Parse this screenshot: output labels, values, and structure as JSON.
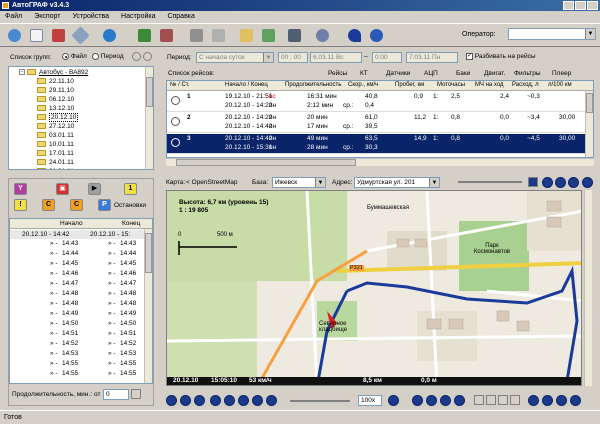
{
  "window": {
    "title": "АвтоГРАФ v3.4.3"
  },
  "menu": [
    "Файл",
    "Экспорт",
    "Устройства",
    "Настройка",
    "Справка"
  ],
  "toolbar": {
    "operator_label": "Оператор:",
    "operator_value": ""
  },
  "groups": {
    "label": "Список групп:",
    "mode_file": "Файл",
    "mode_period": "Период",
    "root": "Автобус - ВА892",
    "dates": [
      "22.11.10",
      "29.11.10",
      "06.12.10",
      "13.12.10",
      "20.12.10",
      "27.12.10",
      "03.01.11",
      "10.01.11",
      "17.01.11",
      "24.01.11",
      "31.01.11"
    ],
    "selected": "20.12.10"
  },
  "period": {
    "label": "Период:",
    "preset": "С начала суток",
    "time_from": "00 : 00",
    "date_from": "6.03.11 Вс",
    "time_to": "0:00",
    "date_to": "7.03.11 Пн",
    "split_label": "Разбивать на рейсы"
  },
  "trips": {
    "label": "Список рейсов:",
    "categories": [
      "Рейсы",
      "КТ",
      "Датчики",
      "АЦП",
      "Баки",
      "Двигат.",
      "Фильтры",
      "Плеер"
    ],
    "headers": [
      "№ / Ст.",
      "Начало / Конец",
      "Продолжительность",
      "Скор., км/ч",
      "Пробег, км",
      "Моточасы",
      "МЧ на ход",
      "Расход, л",
      "л/100 км"
    ],
    "rows": [
      {
        "num": "1",
        "start": "19.12.10 - 21:51",
        "start_day": "вс",
        "end": "20.12.10 - 14:22",
        "end_day": "пн",
        "dur1": "16:31 мин",
        "dur2": "2:12 мин",
        "speed1": "40,8",
        "speed2": "0,4",
        "speed2_label": "ср.:",
        "dist": "0,9",
        "moto": "1:",
        "moto_val": "2,5",
        "mch": "2,4",
        "fuel": "~0,3"
      },
      {
        "num": "2",
        "start": "20.12.10 - 14:22",
        "start_day": "пн",
        "end": "20.12.10 - 14:42",
        "end_day": "пн",
        "dur1": "20 мин",
        "dur2": "17 мин",
        "speed1": "61,0",
        "speed2": "39,5",
        "speed2_label": "ср.:",
        "dist": "11,2",
        "moto": "1:",
        "moto_val": "0,8",
        "mch": "0,0",
        "fuel": "~3,4",
        "per100": "30,00"
      },
      {
        "num": "3",
        "start": "20.12.10 - 14:42",
        "start_day": "пн",
        "end": "20.12.10 - 15:31",
        "end_day": "пн",
        "dur1": "49 мин",
        "dur2": "28 мин",
        "speed1": "63,5",
        "speed2": "30,3",
        "speed2_label": "ср.:",
        "dist": "14,9",
        "moto": "1:",
        "moto_val": "0,8",
        "mch": "0,0",
        "fuel": "~4,5",
        "per100": "30,00"
      }
    ]
  },
  "stops": {
    "label": "Остановки",
    "headers": [
      "Начало",
      "Конец"
    ],
    "first": {
      "start": "20.12.10 - 14:42",
      "end": "20.12.10 - 15:"
    },
    "times": [
      "14:43",
      "14:44",
      "14:45",
      "14:46",
      "14:47",
      "14:48",
      "14:48",
      "14:49",
      "14:50",
      "14:51",
      "14:52",
      "14:53",
      "14:55",
      "14:55"
    ],
    "duration_label": "Продолжительность, мин.:",
    "duration_from_label": "от",
    "duration_value": "0"
  },
  "map": {
    "label": "Карта:",
    "provider": "< OpenStreetMap",
    "base_label": "База:",
    "base": "Ижевск",
    "address_label": "Адрес:",
    "address": "Удмуртская ул. 201",
    "height_info": "Высота: 6,7 км (уровень 15)",
    "scale": "1 : 19 805",
    "scale_zero": "0",
    "scale_len": "500 м",
    "labels": {
      "park": "Парк Космонавтов",
      "cemetery": "Северное кладбище",
      "road": "Р321",
      "street": "Буммашевская"
    },
    "info_date": "20.12.10",
    "info_time": "15:05:10",
    "info_speed": "53 км/ч",
    "info_dist": "8,5 км",
    "info_alt": "0,0 м",
    "zoom": "100x"
  },
  "colors": {
    "track": "#1a3a9a",
    "selected_row": "#0a246a",
    "title_start": "#0a246a",
    "title_end": "#3a6ea5"
  },
  "status": "Готов"
}
